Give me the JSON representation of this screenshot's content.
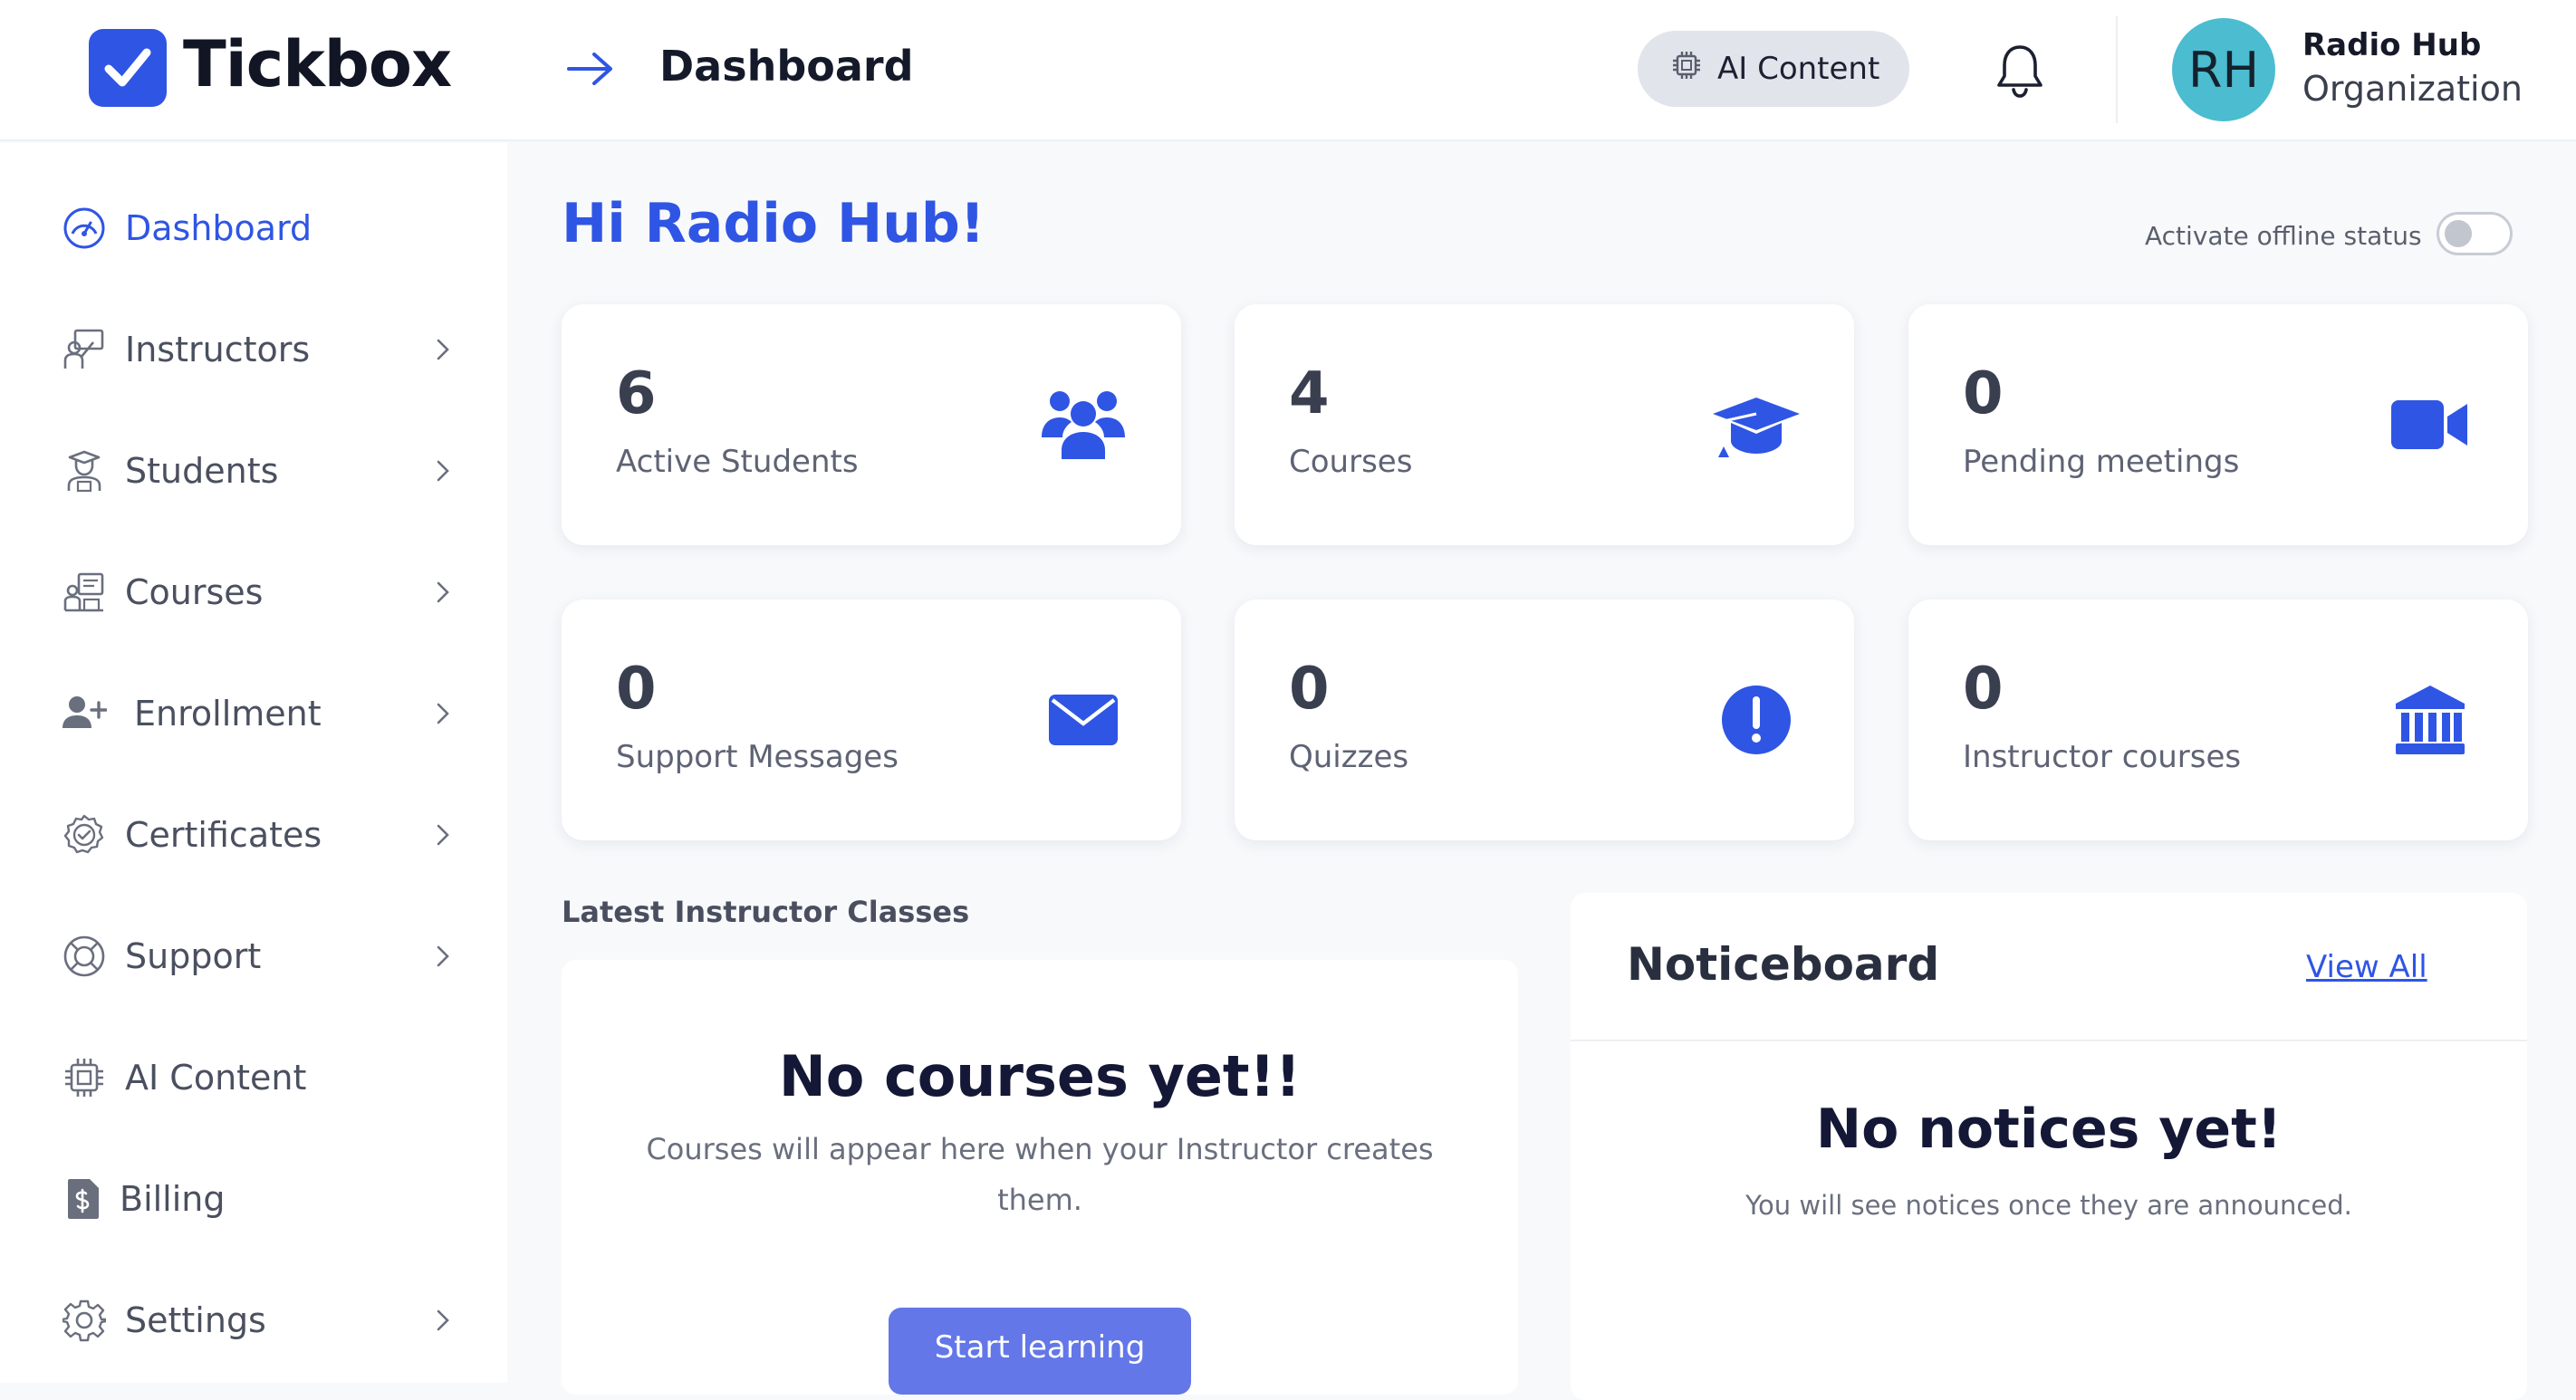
{
  "app": {
    "logo_text": "Tickbox",
    "page_title": "Dashboard"
  },
  "header": {
    "ai_button_label": "AI Content",
    "user_initials": "RH",
    "user_name": "Radio Hub",
    "user_org": "Organization",
    "avatar_color": "#4cbcd0"
  },
  "sidebar": {
    "items": [
      {
        "label": "Dashboard",
        "icon": "dashboard-gauge-icon",
        "active": true
      },
      {
        "label": "Instructors",
        "icon": "instructor-icon"
      },
      {
        "label": "Students",
        "icon": "student-icon"
      },
      {
        "label": "Courses",
        "icon": "courses-icon"
      },
      {
        "label": "Enrollment",
        "icon": "add-user-icon"
      },
      {
        "label": "Certificates",
        "icon": "certificate-badge-icon"
      },
      {
        "label": "Support",
        "icon": "lifebuoy-icon"
      },
      {
        "label": "AI Content",
        "icon": "chip-icon"
      },
      {
        "label": "Billing",
        "icon": "billing-doc-icon"
      },
      {
        "label": "Settings",
        "icon": "gear-icon"
      }
    ]
  },
  "main": {
    "greeting": "Hi Radio Hub!",
    "offline_label": "Activate offline status",
    "offline_active": false,
    "stats": [
      {
        "value": "6",
        "label": "Active Students",
        "icon": "users-group-icon"
      },
      {
        "value": "4",
        "label": "Courses",
        "icon": "graduation-cap-icon"
      },
      {
        "value": "0",
        "label": "Pending meetings",
        "icon": "video-camera-icon"
      },
      {
        "value": "0",
        "label": "Support Messages",
        "icon": "envelope-icon"
      },
      {
        "value": "0",
        "label": "Quizzes",
        "icon": "exclamation-circle-icon"
      },
      {
        "value": "0",
        "label": "Instructor courses",
        "icon": "institution-icon"
      }
    ],
    "classes": {
      "section_title": "Latest Instructor Classes",
      "empty_title": "No courses yet!!",
      "empty_sub_1": "Courses will appear here when your Instructor creates",
      "empty_sub_2": "them.",
      "button_label": "Start learning"
    },
    "noticeboard": {
      "title": "Noticeboard",
      "view_all": "View All",
      "empty_title": "No notices yet!",
      "empty_sub": "You will see notices once they are announced."
    }
  },
  "colors": {
    "accent": "#2f55e4",
    "button": "#6377e8"
  }
}
